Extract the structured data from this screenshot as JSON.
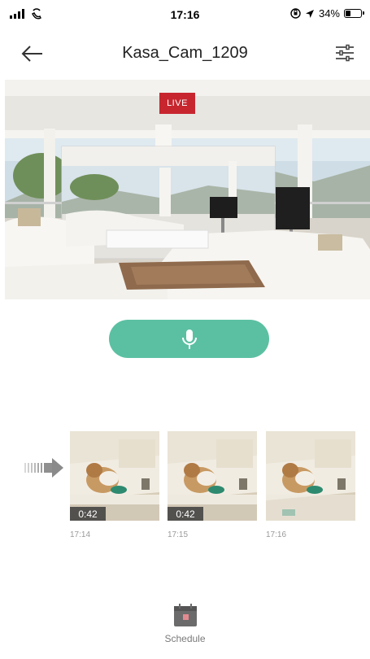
{
  "status_bar": {
    "time": "17:16",
    "battery_percent": "34%",
    "battery_level": 0.34
  },
  "header": {
    "title": "Kasa_Cam_1209"
  },
  "live_view": {
    "badge": "LIVE"
  },
  "clips": [
    {
      "duration": "0:42",
      "time": "17:14"
    },
    {
      "duration": "0:42",
      "time": "17:15"
    },
    {
      "duration": "",
      "time": "17:16"
    }
  ],
  "bottom": {
    "schedule_label": "Schedule"
  },
  "colors": {
    "accent": "#5bc0a2",
    "live": "#c7262f",
    "schedule_icon": "#6b6b6b"
  },
  "icons": {
    "back": "arrow-left-icon",
    "settings": "sliders-icon",
    "mic": "microphone-icon",
    "schedule": "calendar-icon"
  }
}
